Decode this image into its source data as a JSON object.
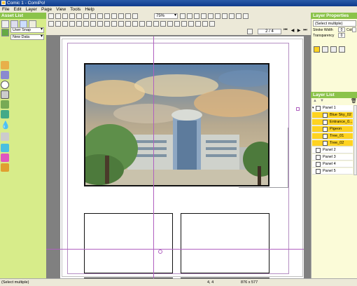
{
  "window": {
    "title": "Comic 1 - ComiPo!"
  },
  "menu": [
    "File",
    "Edit",
    "Layer",
    "Page",
    "View",
    "Tools",
    "Help"
  ],
  "asset_list": {
    "header": "Asset List",
    "category": "User Snap",
    "sub_category": "New Data"
  },
  "toolbar": {
    "zoom": "75%",
    "page_indicator": "2 / 4"
  },
  "layer_properties": {
    "header": "Layer Properties",
    "selection": "(Select multiple)",
    "stroke_width_label": "Stroke Width",
    "stroke_width_value": "0",
    "color_label": "Color",
    "transparency_label": "Transparency",
    "transparency_value": "0"
  },
  "layer_list": {
    "header": "Layer List",
    "layers": [
      {
        "name": "Panel 1",
        "level": 0,
        "selected": false,
        "expanded": true
      },
      {
        "name": "Blue Sky_02",
        "level": 1,
        "selected": true
      },
      {
        "name": "Entrance_0...",
        "level": 1,
        "selected": true
      },
      {
        "name": "Pigeon",
        "level": 1,
        "selected": true
      },
      {
        "name": "Tree_01",
        "level": 1,
        "selected": true
      },
      {
        "name": "Tree_02",
        "level": 1,
        "selected": true
      },
      {
        "name": "Panel 2",
        "level": 0,
        "selected": false
      },
      {
        "name": "Panel 3",
        "level": 0,
        "selected": false
      },
      {
        "name": "Panel 4",
        "level": 0,
        "selected": false
      },
      {
        "name": "Panel 5",
        "level": 0,
        "selected": false
      }
    ]
  },
  "status": {
    "selection": "(Select multiple)",
    "coords": "4, 4",
    "size": "876 x 577"
  },
  "colors": {
    "green_header": "#8bc34a",
    "asset_panel": "#d7ec8a",
    "selected_layer": "#ffd320",
    "guide": "#b060c0"
  }
}
